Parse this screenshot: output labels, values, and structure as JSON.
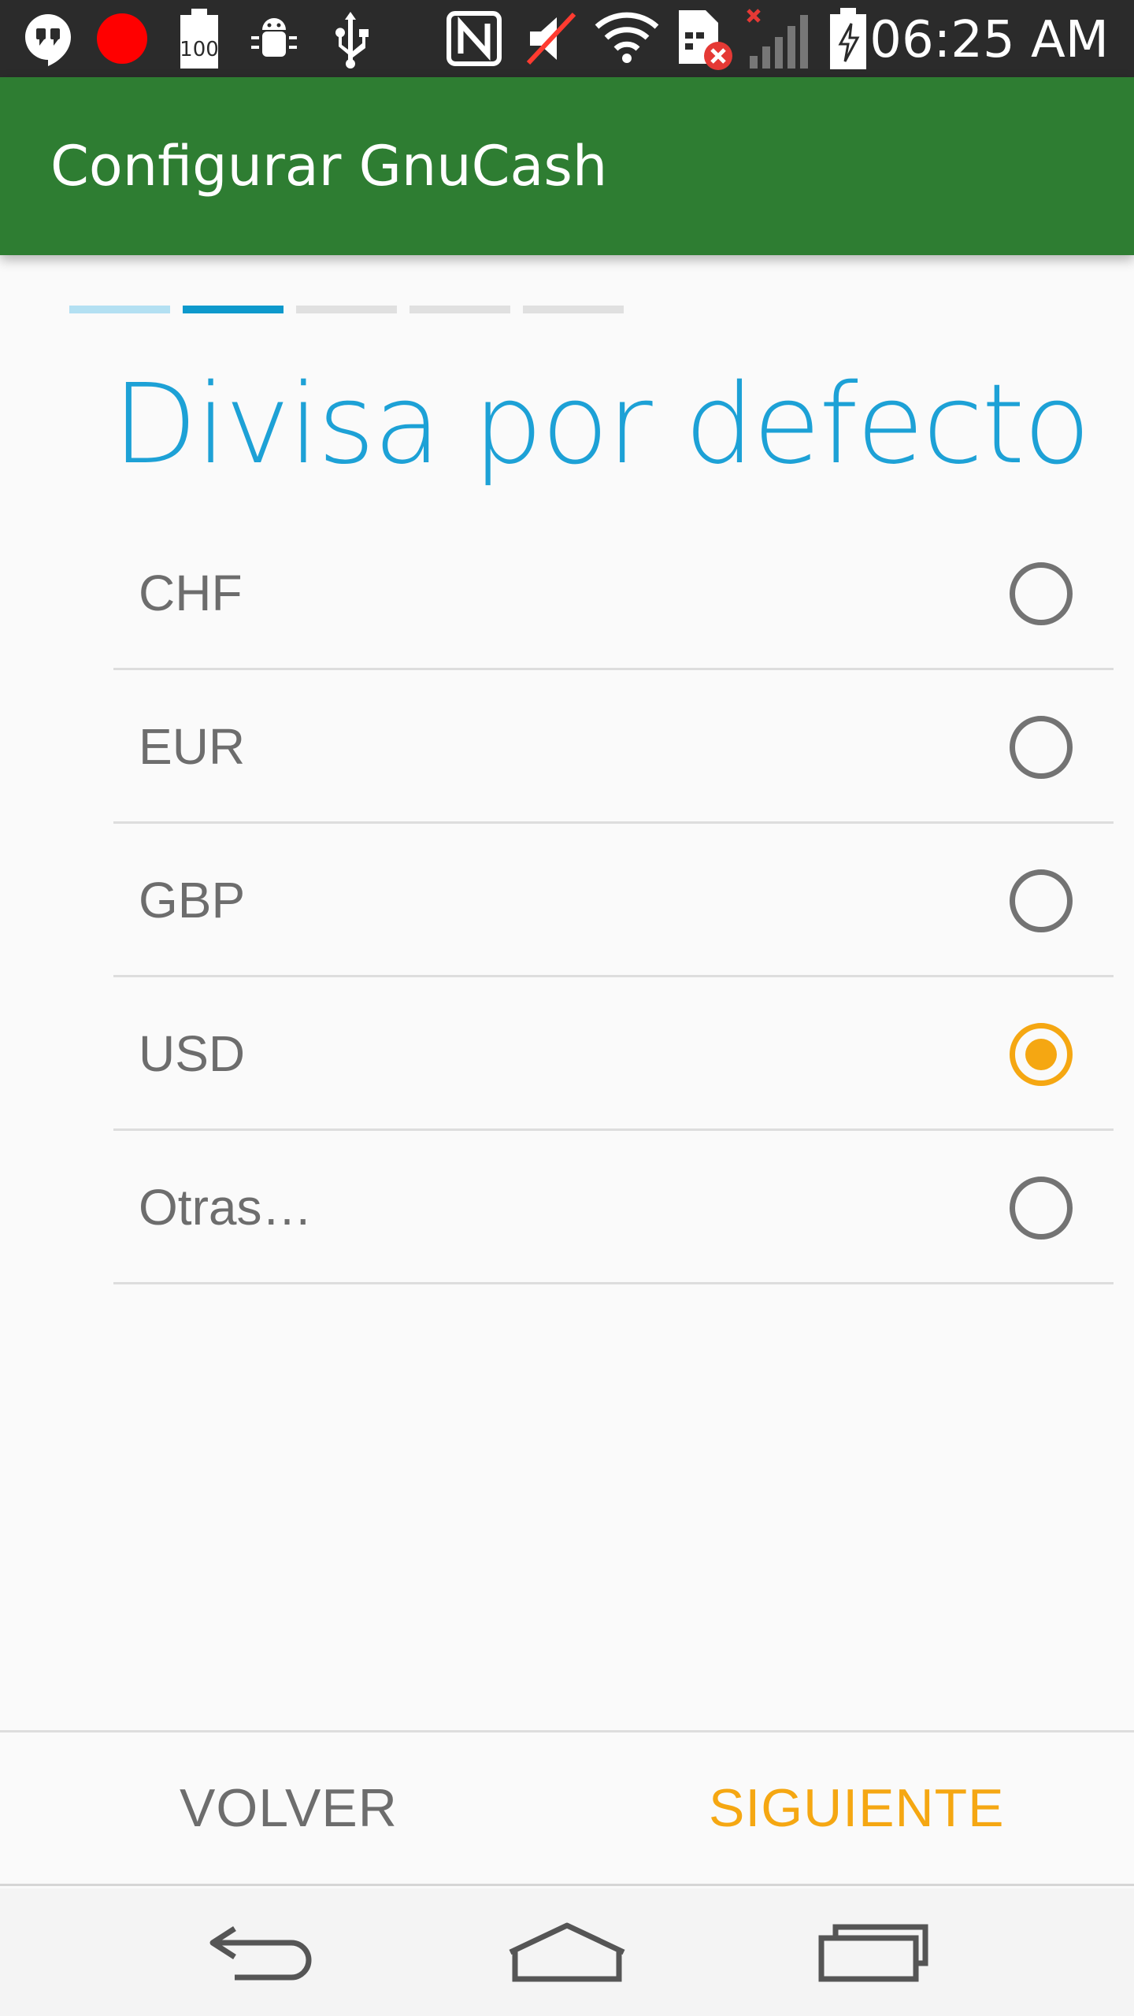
{
  "status_bar": {
    "time": "06:25 AM",
    "battery_level_text": "100",
    "icons": [
      "hangouts-icon",
      "record-dot-icon",
      "battery-100-icon",
      "android-debug-icon",
      "usb-icon",
      "nfc-icon",
      "volume-muted-icon",
      "wifi-icon",
      "sim-error-icon",
      "signal-none-icon",
      "battery-charging-icon"
    ]
  },
  "app_bar": {
    "title": "Configurar GnuCash"
  },
  "steps": {
    "total": 5,
    "current": 2
  },
  "page": {
    "heading": "Divisa por defecto"
  },
  "currencies": [
    {
      "label": "CHF",
      "selected": false
    },
    {
      "label": "EUR",
      "selected": false
    },
    {
      "label": "GBP",
      "selected": false
    },
    {
      "label": "USD",
      "selected": true
    },
    {
      "label": "Otras…",
      "selected": false
    }
  ],
  "buttons": {
    "back_label": "VOLVER",
    "next_label": "SIGUIENTE"
  },
  "colors": {
    "app_bar": "#2e7d32",
    "heading": "#1da1d6",
    "accent": "#f5a712",
    "step_active": "#0d99cc"
  },
  "nav_bar": {
    "icons": [
      "back-icon",
      "home-icon",
      "recents-icon"
    ]
  }
}
